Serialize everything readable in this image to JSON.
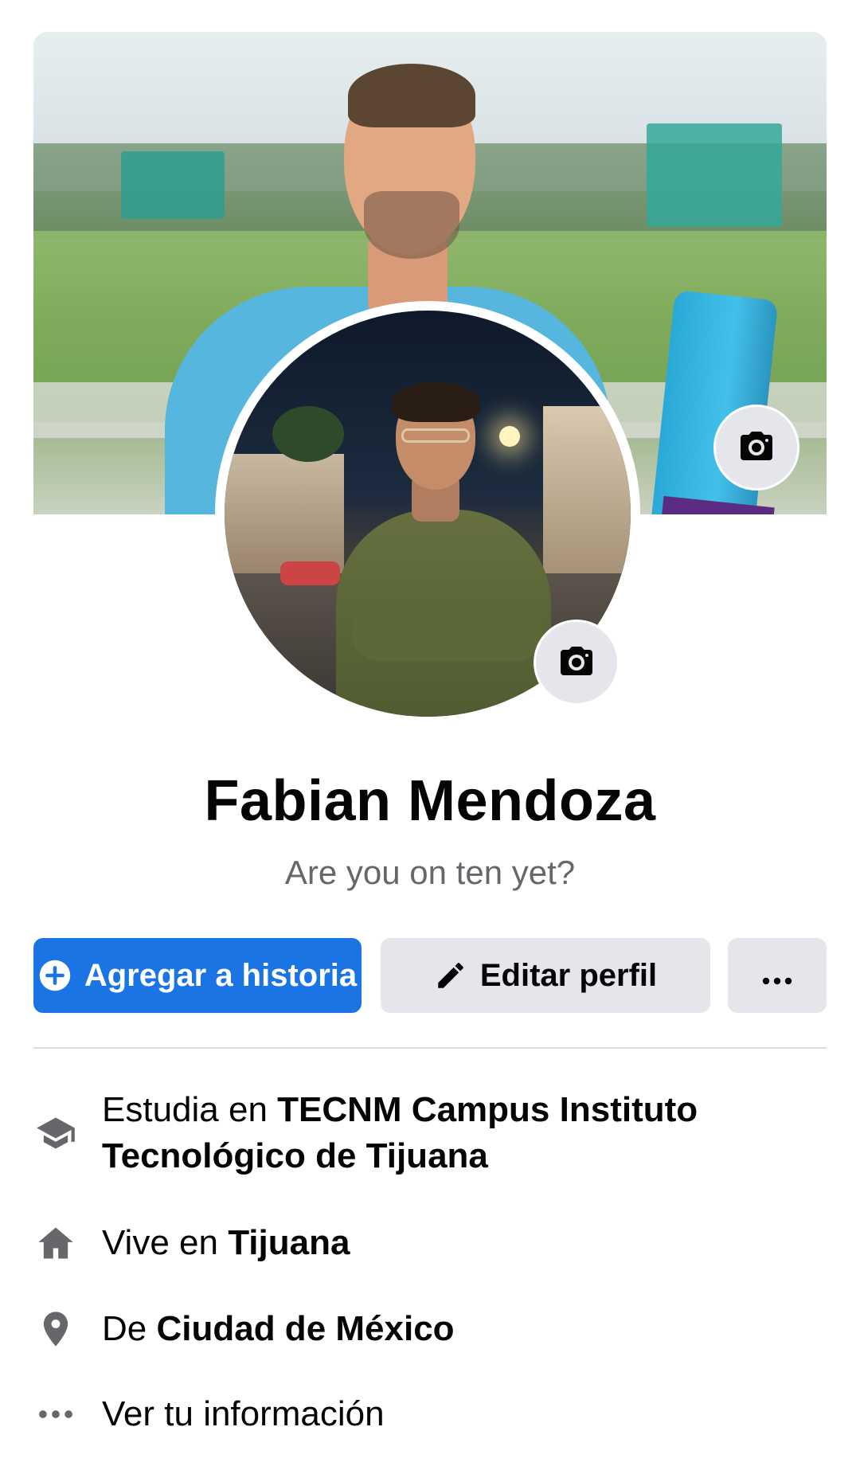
{
  "profile": {
    "name": "Fabian Mendoza",
    "bio": "Are you on ten yet?"
  },
  "actions": {
    "add_story_label": "Agregar a historia",
    "edit_profile_label": "Editar perfil",
    "more_label": "..."
  },
  "info": {
    "study_prefix": "Estudia en ",
    "study_place_line1": "TECNM Campus Instituto",
    "study_place_line2": "Tecnológico de Tijuana",
    "lives_prefix": "Vive en ",
    "lives_place": "Tijuana",
    "from_prefix": "De ",
    "from_place": "Ciudad de México",
    "see_info_label": "Ver tu información"
  },
  "icons": {
    "cover_camera": "camera-icon",
    "avatar_camera": "camera-icon",
    "add_story": "plus-circle-icon",
    "edit": "pencil-icon",
    "more": "ellipsis-icon",
    "study": "graduation-cap-icon",
    "lives": "home-icon",
    "from": "location-pin-icon",
    "see_info": "ellipsis-icon"
  },
  "colors": {
    "primary_blue": "#1b74e4",
    "secondary_button": "#e4e6eb",
    "text_primary": "#050505",
    "text_secondary": "#65676b",
    "icon_gray": "#65676b",
    "divider": "#dadde1"
  }
}
